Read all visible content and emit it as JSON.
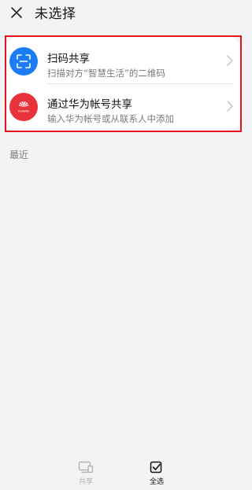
{
  "header": {
    "title": "未选择",
    "close_icon": "close-icon"
  },
  "share_options": [
    {
      "title": "扫码共享",
      "subtitle": "扫描对方“智慧生活”的二维码",
      "icon": "scan-icon",
      "icon_color": "#1b7cf5"
    },
    {
      "title": "通过华为帐号共享",
      "subtitle": "输入华为帐号或从联系人中添加",
      "icon": "huawei-logo-icon",
      "icon_color": "#e8333a"
    }
  ],
  "recent": {
    "label": "最近"
  },
  "bottom_bar": {
    "share": {
      "label": "共享",
      "icon": "share-device-icon",
      "enabled": false
    },
    "select_all": {
      "label": "全选",
      "icon": "select-all-checkbox-icon",
      "enabled": true
    }
  },
  "colors": {
    "highlight_border": "#e5131b",
    "background": "#f1f3f5",
    "card": "#ffffff"
  }
}
